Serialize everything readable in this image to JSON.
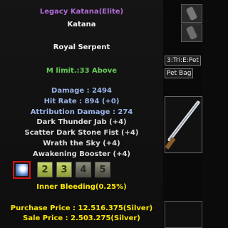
{
  "tooltip": {
    "elite_name": "Legacy Katana(Elite)",
    "item_type": "Katana",
    "item_name": "Royal Serpent",
    "mlimit": "M limit.:33 Above",
    "stats": {
      "damage": "Damage : 2494",
      "hit_rate": "Hit Rate : 894 (+0)",
      "attribution_damage": "Attribution Damage : 274"
    },
    "skills": [
      "Dark Thunder Jab (+4)",
      "Scatter Dark Stone Fist (+4)",
      "Wrath the Sky (+4)",
      "Awakening Booster (+4)"
    ],
    "gems": [
      "2",
      "3",
      "4",
      "5"
    ],
    "status_effect": "Inner Bleeding(0.25%)",
    "purchase_price": "Purchase Price : 12.516.375(Silver)",
    "sale_price": "Sale Price : 2.503.275(Silver)"
  },
  "right_panel": {
    "tab_labels": [
      "3:Tri:E:Pet",
      "Pet Bag"
    ]
  }
}
